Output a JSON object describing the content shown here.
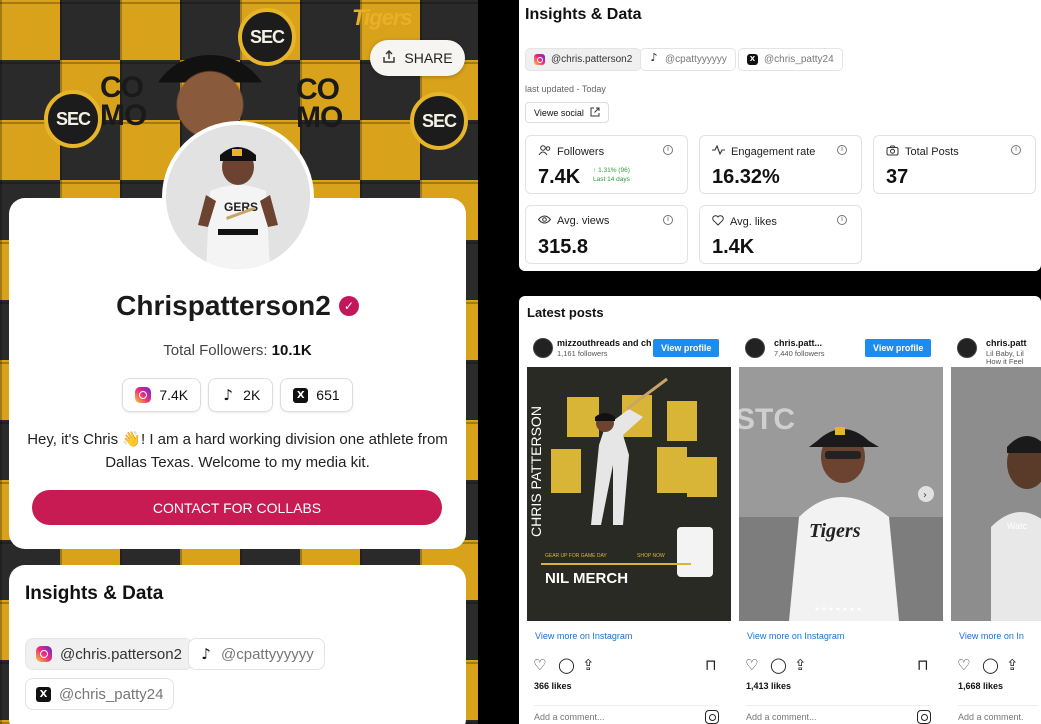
{
  "profile": {
    "share_label": "SHARE",
    "name": "Chrispatterson2",
    "total_label": "Total Followers:",
    "total_value": "10.1K",
    "chips": [
      {
        "platform": "instagram",
        "count": "7.4K"
      },
      {
        "platform": "tiktok",
        "count": "2K"
      },
      {
        "platform": "x",
        "count": "651"
      }
    ],
    "bio": "Hey, it's Chris 👋! I am a hard working division one athlete from Dallas Texas. Welcome to my media kit.",
    "cta": "CONTACT FOR COLLABS",
    "background_tiles": [
      "SEC",
      "CO MO",
      "Tigers"
    ]
  },
  "insights_left": {
    "title": "Insights & Data",
    "handles": [
      {
        "platform": "instagram",
        "label": "@chris.patterson2"
      },
      {
        "platform": "tiktok",
        "label": "@cpattyyyyyy"
      },
      {
        "platform": "x",
        "label": "@chris_patty24"
      }
    ]
  },
  "insights_right": {
    "title": "Insights & Data",
    "handles": [
      {
        "platform": "instagram",
        "label": "@chris.patterson2"
      },
      {
        "platform": "tiktok",
        "label": "@cpattyyyyyy"
      },
      {
        "platform": "x",
        "label": "@chris_patty24"
      }
    ],
    "updated": "last updated - Today",
    "view_social": "Viewe social",
    "stats": [
      {
        "label": "Followers",
        "value": "7.4K",
        "icon": "users-icon",
        "trend": "1.31% (96)",
        "trend_sub": "Last 14 days"
      },
      {
        "label": "Engagement rate",
        "value": "16.32%",
        "icon": "activity-icon"
      },
      {
        "label": "Total Posts",
        "value": "37",
        "icon": "camera-icon"
      },
      {
        "label": "Avg. views",
        "value": "315.8",
        "icon": "eye-icon"
      },
      {
        "label": "Avg. likes",
        "value": "1.4K",
        "icon": "heart-icon"
      }
    ]
  },
  "latest": {
    "title": "Latest posts",
    "posts": [
      {
        "account": "mizzouthreads and ch",
        "followers": "1,161 followers",
        "view_profile": "View profile",
        "view_more": "View more on Instagram",
        "likes": "366 likes",
        "comment": "Add a comment...",
        "image_caption": "NIL MERCH",
        "image_side_text": "CHRIS PATTERSON",
        "image_sub": "GEAR UP FOR GAME DAY",
        "image_shop": "SHOP NOW"
      },
      {
        "account": "chris.patt...",
        "followers": "7,440 followers",
        "view_profile": "View profile",
        "view_more": "View more on Instagram",
        "likes": "1,413 likes",
        "comment": "Add a comment...",
        "image_caption": "Tigers"
      },
      {
        "account": "chris.patt",
        "followers": "Lil Baby, Lil",
        "followers2": "How it Feel",
        "view_more": "View more on In",
        "likes": "1,668 likes",
        "comment": "Add a comment.",
        "image_caption": "Watc"
      }
    ]
  }
}
